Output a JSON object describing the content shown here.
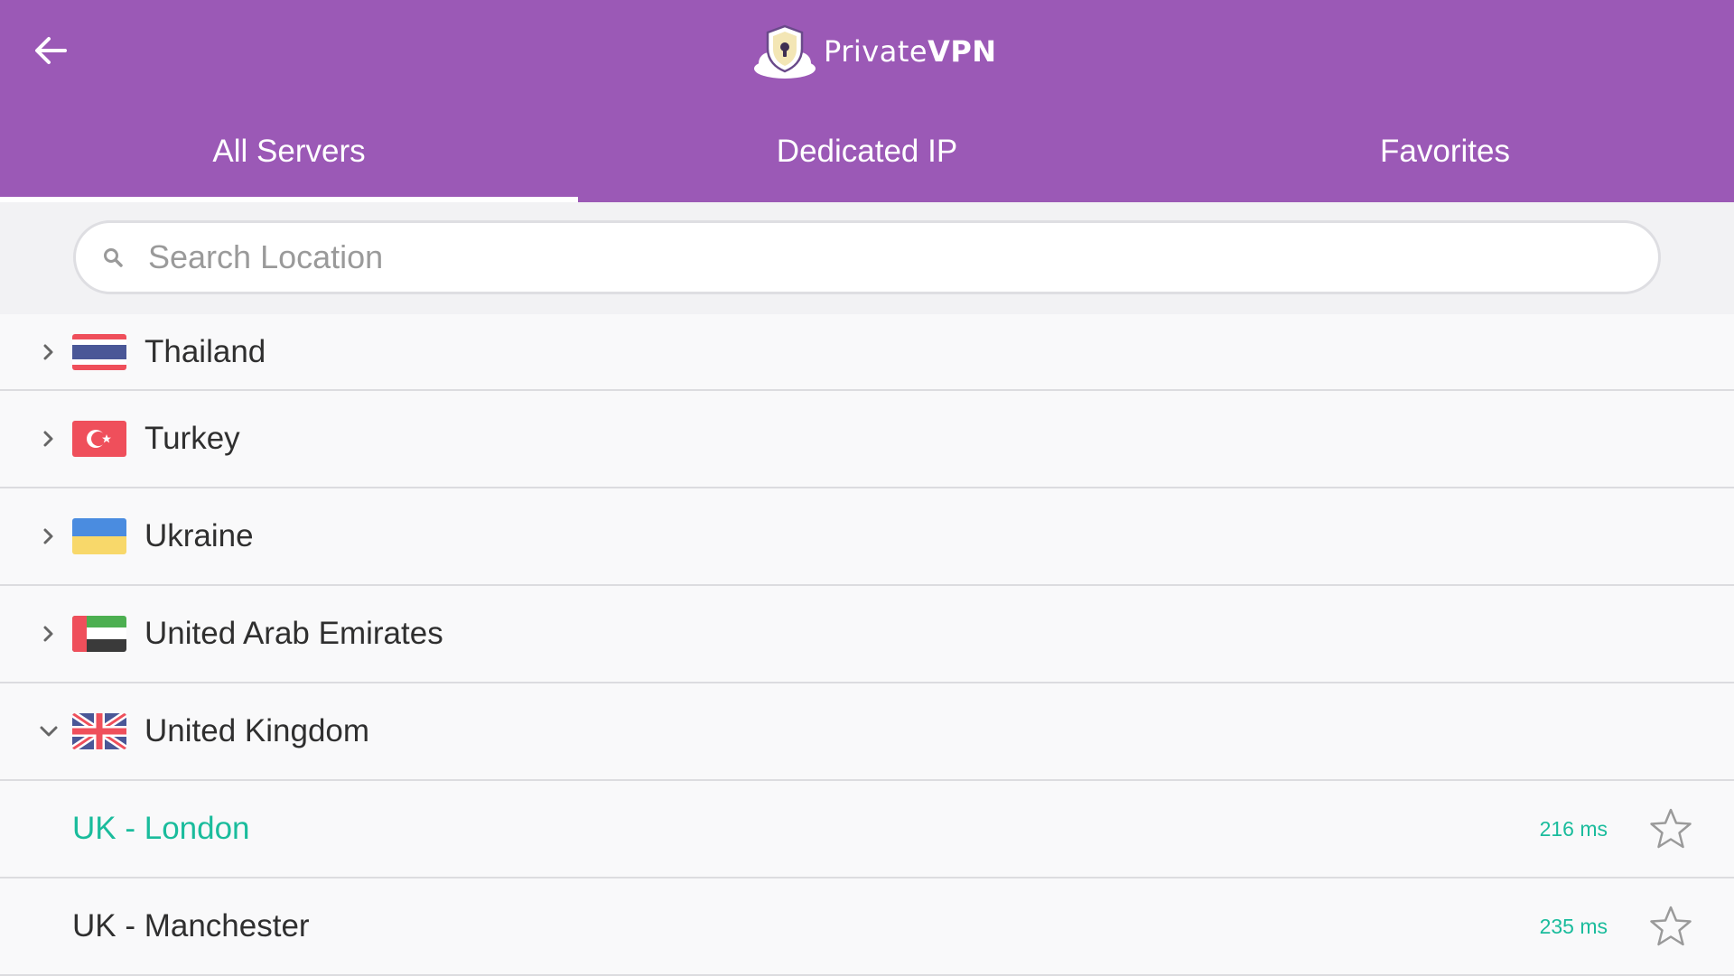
{
  "header": {
    "brand_light": "Private",
    "brand_bold": "VPN",
    "colors": {
      "background": "#9b59b6",
      "accent": "#1abc9c"
    }
  },
  "tabs": [
    {
      "label": "All Servers",
      "active": true
    },
    {
      "label": "Dedicated IP",
      "active": false
    },
    {
      "label": "Favorites",
      "active": false
    }
  ],
  "search": {
    "placeholder": "Search Location",
    "value": ""
  },
  "countries": [
    {
      "name": "Thailand",
      "expanded": false,
      "flag": "thailand-flag"
    },
    {
      "name": "Turkey",
      "expanded": false,
      "flag": "turkey-flag"
    },
    {
      "name": "Ukraine",
      "expanded": false,
      "flag": "ukraine-flag"
    },
    {
      "name": "United Arab Emirates",
      "expanded": false,
      "flag": "uae-flag"
    },
    {
      "name": "United Kingdom",
      "expanded": true,
      "flag": "uk-flag"
    }
  ],
  "servers": [
    {
      "name": "UK - London",
      "ping": "216 ms",
      "selected": true,
      "favorite": false
    },
    {
      "name": "UK - Manchester",
      "ping": "235 ms",
      "selected": false,
      "favorite": false
    }
  ]
}
